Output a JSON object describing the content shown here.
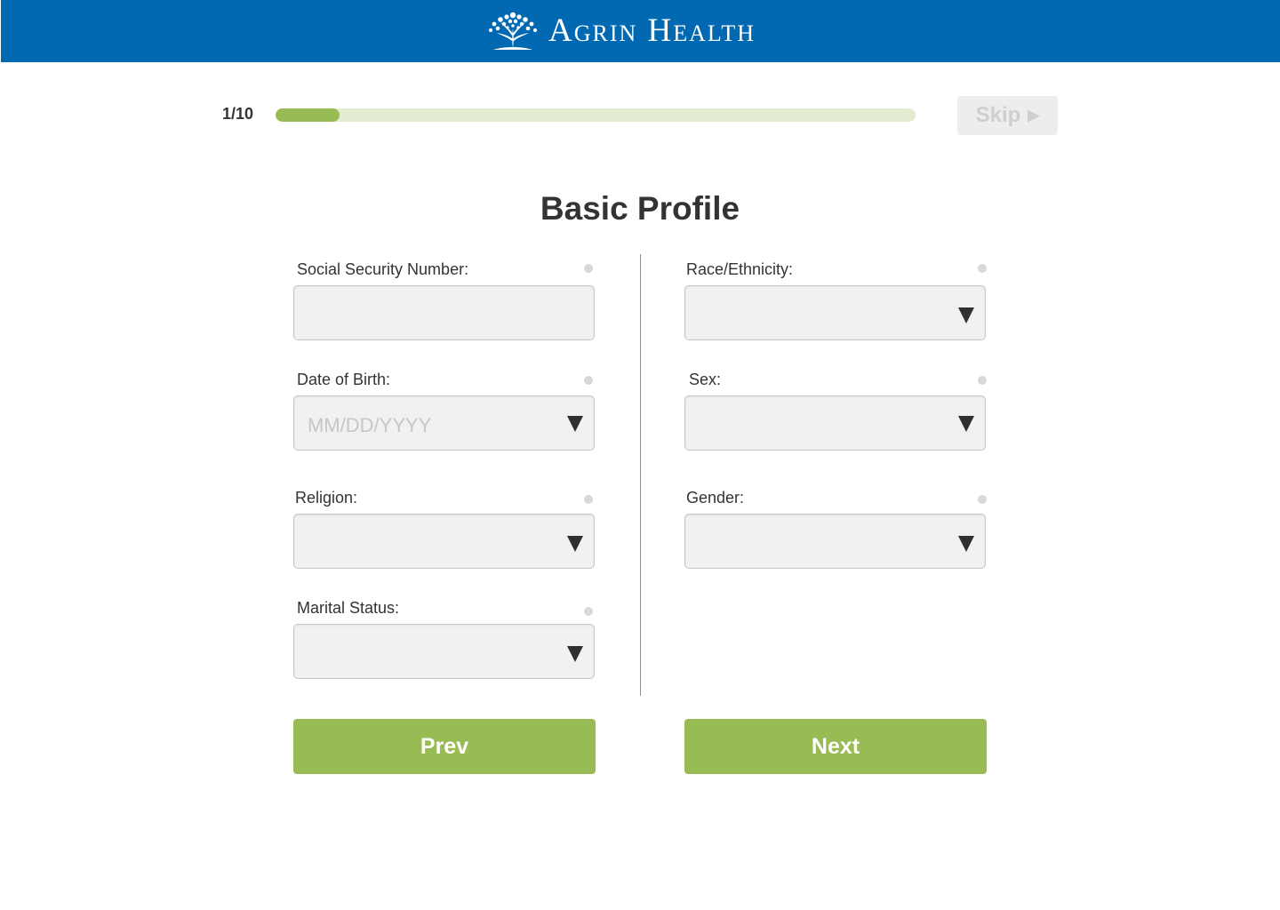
{
  "header": {
    "brand_name": "Agrin Health",
    "logo_icon": "tree-icon",
    "background_color": "#0069b1"
  },
  "progress": {
    "label": "1/10",
    "current_step": 1,
    "total_steps": 10,
    "fill_color": "#99bb53",
    "track_color": "#e1ecd0"
  },
  "skip": {
    "label": "Skip",
    "icon": "play-arrow-icon",
    "arrow_glyph": "▶",
    "disabled": true
  },
  "page_title": "Basic Profile",
  "form": {
    "left": [
      {
        "label": "Social Security Number:",
        "type": "text",
        "value": "",
        "placeholder": ""
      },
      {
        "label": "Date of Birth:",
        "type": "select",
        "value": "",
        "placeholder": "MM/DD/YYYY"
      },
      {
        "label": "Religion:",
        "type": "select",
        "value": "",
        "placeholder": ""
      },
      {
        "label": "Marital Status:",
        "type": "select",
        "value": "",
        "placeholder": ""
      }
    ],
    "right": [
      {
        "label": "Race/Ethnicity:",
        "type": "select",
        "value": "",
        "placeholder": ""
      },
      {
        "label": "Sex:",
        "type": "select",
        "value": "",
        "placeholder": ""
      },
      {
        "label": "Gender:",
        "type": "select",
        "value": "",
        "placeholder": ""
      }
    ]
  },
  "buttons": {
    "prev_label": "Prev",
    "next_label": "Next",
    "color": "#99bb53"
  }
}
